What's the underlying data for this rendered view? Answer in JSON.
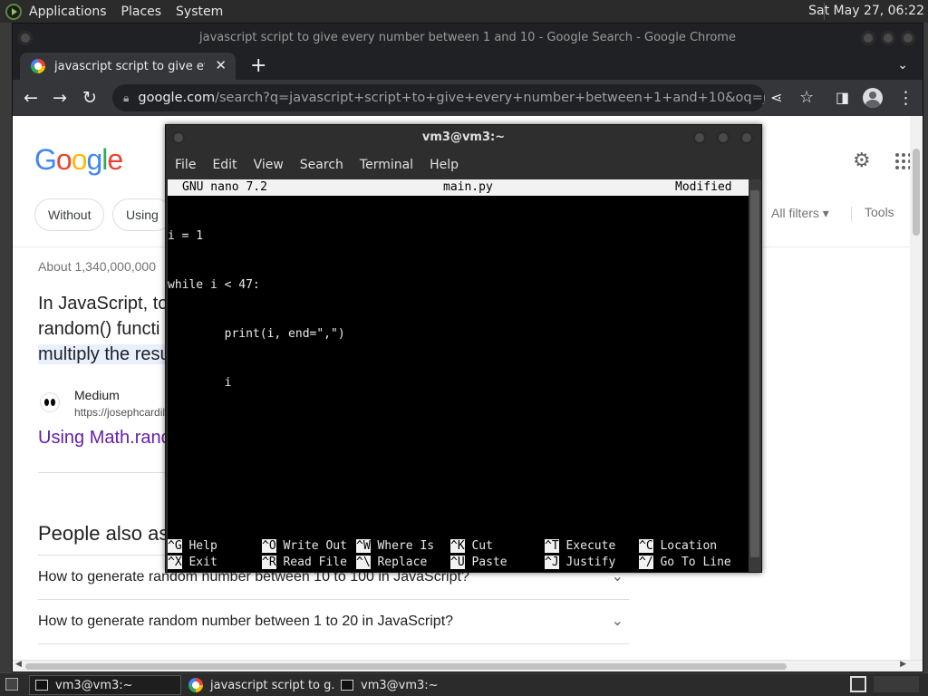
{
  "top_panel": {
    "menus": [
      "Applications",
      "Places",
      "System"
    ],
    "clock": "Sat May 27, 06:22"
  },
  "chrome": {
    "window_title": "javascript script to give every number between 1 and 10 - Google Search - Google Chrome",
    "tab_title": "javascript script to give every n",
    "new_tab_label": "+",
    "url_domain": "google.com",
    "url_path": "/search?q=javascript+script+to+give+every+number+between+1+and+10&oq=javascript+script+t..."
  },
  "google": {
    "logo": "Google",
    "chips": [
      "Without",
      "Using"
    ],
    "all_filters": "All filters",
    "tools": "Tools",
    "result_stats": "About 1,340,000,000",
    "snippet_lines": [
      "In JavaScript, to",
      "random() functi",
      "multiply the resu"
    ],
    "source_name": "Medium",
    "source_url": "https://josephcardil",
    "result_link": "Using Math.rand",
    "people_also_ask": "People also as",
    "questions": [
      "How to generate random number between 10 to 100 in JavaScript?",
      "How to generate random number between 1 to 20 in JavaScript?"
    ]
  },
  "terminal": {
    "title": "vm3@vm3:~",
    "menu": [
      "File",
      "Edit",
      "View",
      "Search",
      "Terminal",
      "Help"
    ],
    "nano": {
      "version": "GNU nano 7.2",
      "filename": "main.py",
      "status": "Modified",
      "lines": [
        "i = 1",
        "while i < 47:",
        "        print(i, end=\",\")",
        "        i"
      ],
      "shortcuts_row1": [
        {
          "key": "^G",
          "label": "Help"
        },
        {
          "key": "^O",
          "label": "Write Out"
        },
        {
          "key": "^W",
          "label": "Where Is"
        },
        {
          "key": "^K",
          "label": "Cut"
        },
        {
          "key": "^T",
          "label": "Execute"
        },
        {
          "key": "^C",
          "label": "Location"
        }
      ],
      "shortcuts_row2": [
        {
          "key": "^X",
          "label": "Exit"
        },
        {
          "key": "^R",
          "label": "Read File"
        },
        {
          "key": "^\\",
          "label": "Replace"
        },
        {
          "key": "^U",
          "label": "Paste"
        },
        {
          "key": "^J",
          "label": "Justify"
        },
        {
          "key": "^/",
          "label": "Go To Line"
        }
      ]
    }
  },
  "taskbar": {
    "items": [
      "vm3@vm3:~",
      "javascript script to g...",
      "vm3@vm3:~"
    ]
  }
}
